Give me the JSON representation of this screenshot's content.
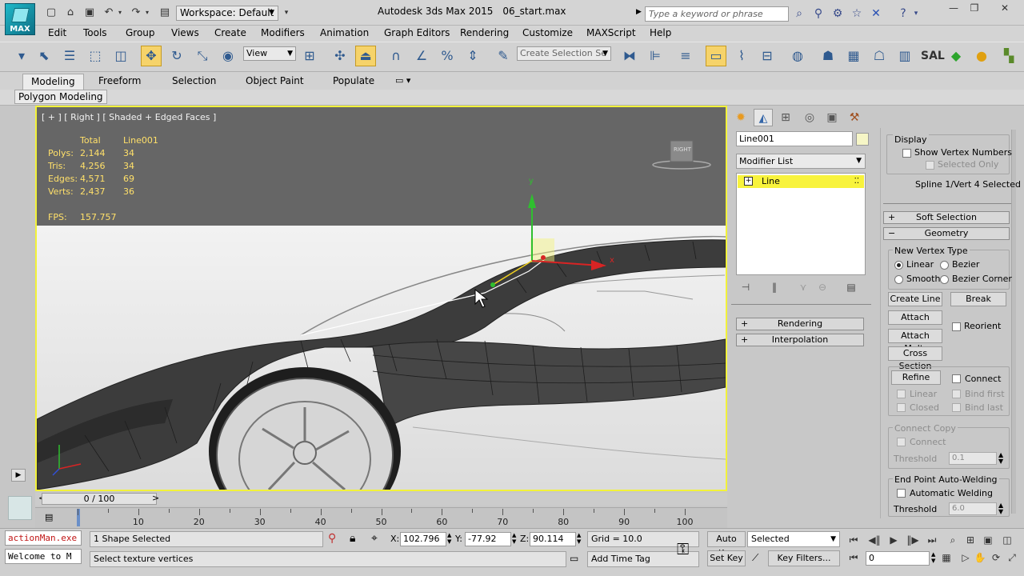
{
  "app": {
    "logo_text": "MAX",
    "title": "Autodesk 3ds Max  2015",
    "file_name": "06_start.max",
    "workspace_label": "Workspace: Default",
    "search_placeholder": "Type a keyword or phrase",
    "window_controls": [
      "minimize",
      "restore",
      "close"
    ]
  },
  "menu": [
    "Edit",
    "Tools",
    "Group",
    "Views",
    "Create",
    "Modifiers",
    "Animation",
    "Graph Editors",
    "Rendering",
    "Customize",
    "MAXScript",
    "Help"
  ],
  "toolbar": {
    "reference_coord": "View",
    "selection_set_placeholder": "Create Selection Se"
  },
  "ribbon": {
    "tabs": [
      "Modeling",
      "Freeform",
      "Selection",
      "Object Paint",
      "Populate"
    ],
    "active_tab": "Modeling",
    "panel_label": "Polygon Modeling"
  },
  "viewport": {
    "label": "[ + ] [ Right ] [ Shaded + Edged Faces ]",
    "stats_header": [
      "",
      "Total",
      "Line001"
    ],
    "stats": [
      {
        "label": "Polys:",
        "total": "2,144",
        "selected": "34"
      },
      {
        "label": "Tris:",
        "total": "4,256",
        "selected": "34"
      },
      {
        "label": "Edges:",
        "total": "4,571",
        "selected": "69"
      },
      {
        "label": "Verts:",
        "total": "2,437",
        "selected": "36"
      }
    ],
    "fps_label": "FPS:",
    "fps_value": "157.757",
    "viewcube_label": "RIGHT",
    "gizmo_axis_x": "x",
    "gizmo_axis_y": "y"
  },
  "command_panel": {
    "object_name": "Line001",
    "modifier_list": "Modifier List",
    "stack_item": "Line",
    "rollouts_left": [
      "Rendering",
      "Interpolation"
    ],
    "display": {
      "title": "Display",
      "show_vertex_numbers": "Show Vertex Numbers",
      "selected_only": "Selected Only",
      "status": "Spline 1/Vert 4 Selected"
    },
    "rollouts_right": [
      "Soft Selection",
      "Geometry"
    ],
    "geometry": {
      "new_vertex_type": "New Vertex Type",
      "linear": "Linear",
      "bezier": "Bezier",
      "smooth": "Smooth",
      "bezier_corner": "Bezier Corner",
      "create_line": "Create Line",
      "break": "Break",
      "attach": "Attach",
      "reorient": "Reorient",
      "attach_mult": "Attach Mult.",
      "cross_section": "Cross Section",
      "refine": "Refine",
      "connect": "Connect",
      "refine_linear": "Linear",
      "bind_first": "Bind first",
      "closed": "Closed",
      "bind_last": "Bind last",
      "connect_copy": "Connect Copy",
      "connect_copy_connect": "Connect",
      "threshold_label": "Threshold",
      "threshold_value": "0.1",
      "end_point_welding": "End Point Auto-Welding",
      "automatic_welding": "Automatic Welding",
      "weld_threshold_label": "Threshold",
      "weld_threshold_value": "6.0"
    }
  },
  "timeline": {
    "frame_display": "0 / 100",
    "ticks": [
      "0",
      "10",
      "20",
      "30",
      "40",
      "50",
      "60",
      "70",
      "80",
      "90",
      "100"
    ]
  },
  "status": {
    "maxscript_line1": "actionMan.exe",
    "maxscript_line2": "Welcome to M",
    "selection": "1 Shape Selected",
    "prompt": "Select texture vertices",
    "x_label": "X:",
    "x_value": "102.796",
    "y_label": "Y:",
    "y_value": "-77.92",
    "z_label": "Z:",
    "z_value": "90.114",
    "grid": "Grid = 10.0",
    "add_time_tag": "Add Time Tag",
    "auto_key": "Auto Key",
    "set_key": "Set Key",
    "key_mode": "Selected",
    "key_filters": "Key Filters...",
    "current_frame": "0"
  },
  "colors": {
    "viewport_border": "#f2f23a",
    "stats_text": "#ffe06a",
    "active_button": "#f6d36a",
    "stack_highlight": "#f8f33c",
    "gizmo_y": "#2fbf2f",
    "gizmo_x": "#d82424"
  }
}
